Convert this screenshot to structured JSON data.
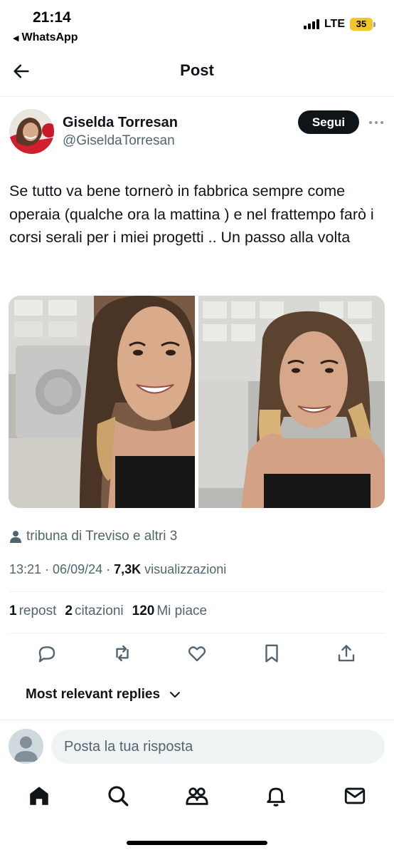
{
  "status_bar": {
    "time": "21:14",
    "back_app": "WhatsApp",
    "network": "LTE",
    "battery": "35"
  },
  "header": {
    "title": "Post"
  },
  "post": {
    "author_name": "Giselda Torresan",
    "author_handle": "@GiseldaTorresan",
    "follow_label": "Segui",
    "text": "Se tutto va bene tornerò in fabbrica sempre come operaia (qualche ora la mattina ) e nel frattempo farò i corsi serali per i miei progetti .. Un passo alla volta",
    "location": "tribuna di Treviso e altri 3",
    "time": "13:21",
    "date": "06/09/24",
    "views_count": "7,3K",
    "views_label": "visualizzazioni",
    "stats": {
      "reposts_count": "1",
      "reposts_label": "repost",
      "quotes_count": "2",
      "quotes_label": "citazioni",
      "likes_count": "120",
      "likes_label": "Mi piace"
    }
  },
  "replies": {
    "sort_label": "Most relevant replies"
  },
  "composer": {
    "placeholder": "Posta la tua risposta"
  },
  "tabbar": {
    "items": [
      "home-icon",
      "search-icon",
      "communities-icon",
      "notifications-icon",
      "messages-icon"
    ]
  },
  "colors": {
    "text": "#0f1419",
    "secondary": "#536471",
    "divider": "#eff3f4",
    "battery": "#f4c52b"
  }
}
